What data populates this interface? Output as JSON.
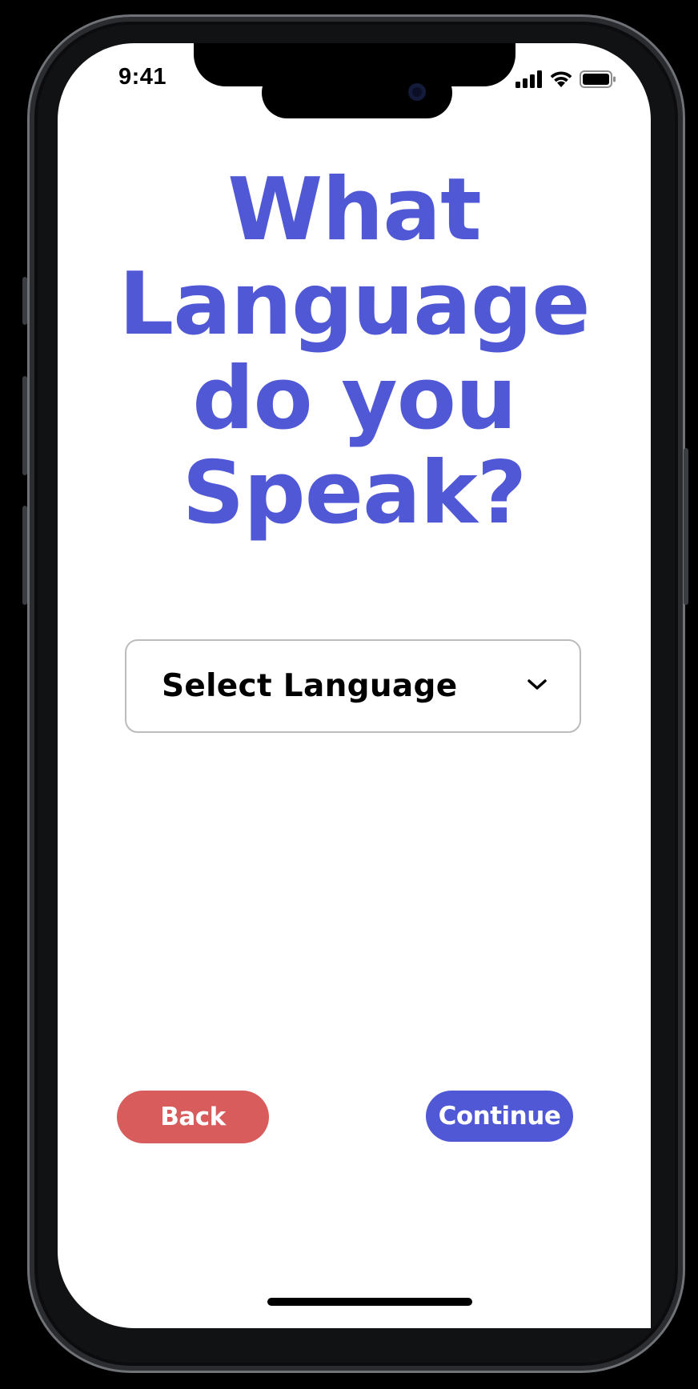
{
  "status_bar": {
    "time": "9:41"
  },
  "onboarding": {
    "title_lines": [
      "What",
      "Language",
      "do you",
      "Speak?"
    ],
    "language_select": {
      "label": "Select Language"
    },
    "back_button": "Back",
    "continue_button": "Continue"
  },
  "colors": {
    "accent": "#5058d6",
    "back": "#d95c5c",
    "text": "#000000",
    "screen_background": "#ffffff"
  },
  "icons": {
    "signal": "signal-icon",
    "wifi": "wifi-icon",
    "battery": "battery-icon",
    "dropdown": "chevron-down-icon"
  }
}
